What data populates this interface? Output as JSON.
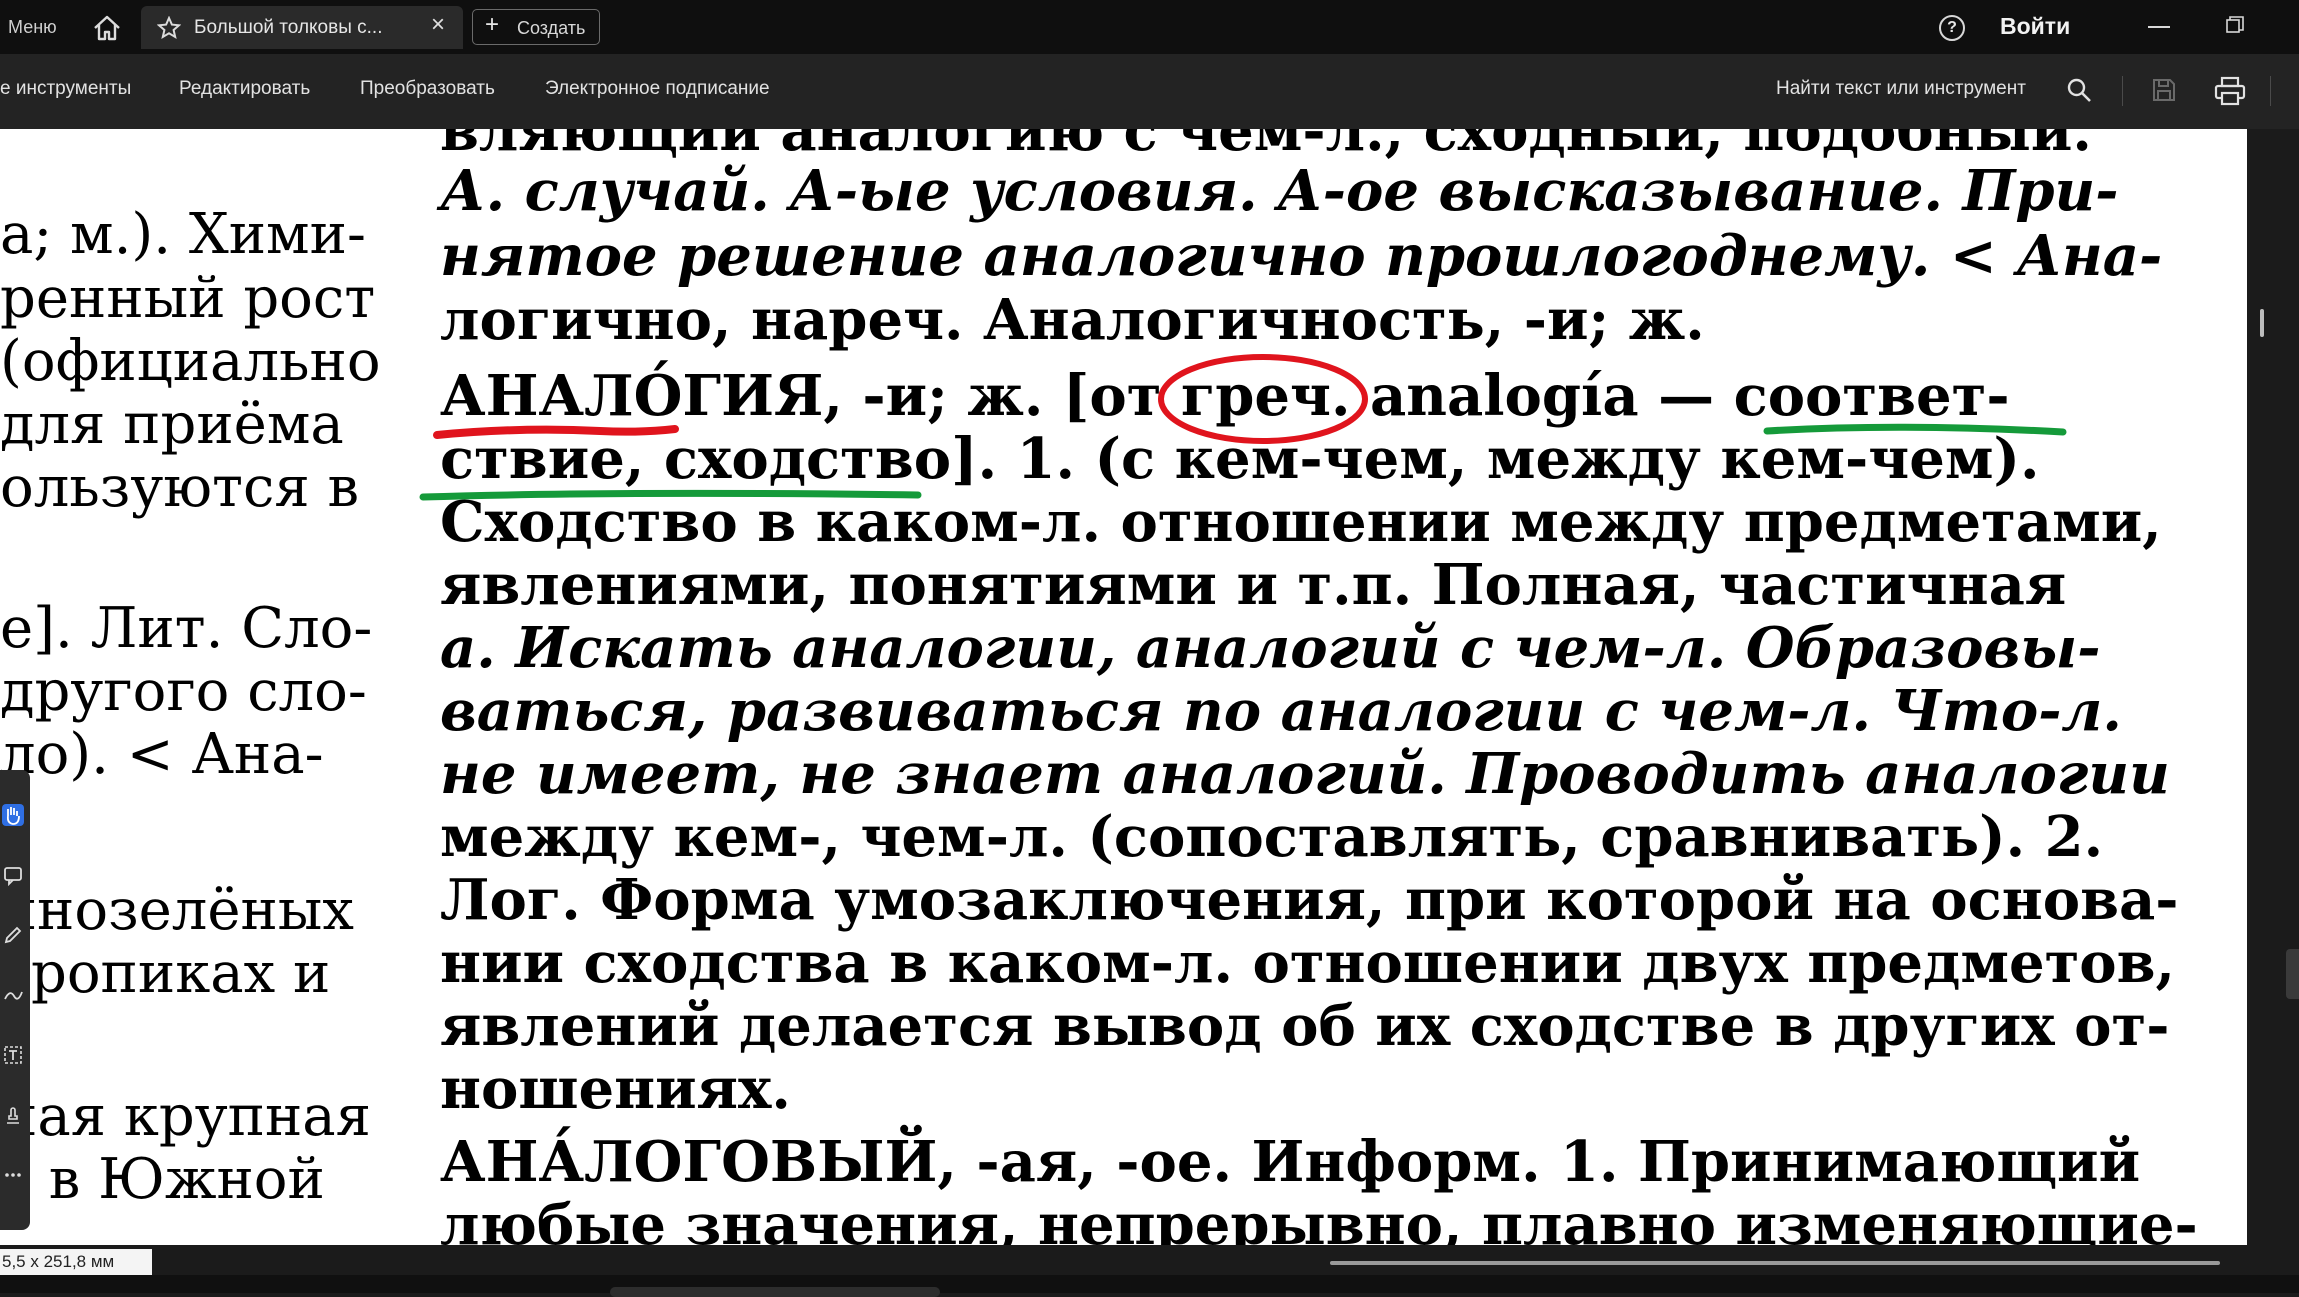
{
  "topbar": {
    "menu_label": "Меню",
    "tab_title": "Большой толковы с...",
    "tab_close": "×",
    "create_label": "Создать",
    "signin_label": "Войти",
    "help_glyph": "?"
  },
  "toolbar": {
    "items": [
      "е инструменты",
      "Редактировать",
      "Преобразовать",
      "Электронное подписание"
    ],
    "search_label": "Найти текст или инструмент"
  },
  "status": {
    "page_size": "5,5 x 251,8 мм"
  },
  "document": {
    "left_lines": [
      "а; м.). Хими-",
      "ренный рост",
      "(официально",
      "для приёма",
      "ользуются в",
      "",
      "е]. Лит. Сло-",
      "другого сло-",
      "ло). < Ана-",
      "",
      "чнозелёных",
      "тропиках и",
      "",
      "ная крупная",
      "т в Южной"
    ],
    "main_lines": [
      "вляющий аналогию с чем-л., сходный, подобный.",
      "А. случай. А-ые условия. А-ое высказывание. При-",
      "нятое решение аналогично прошлогоднему. < Ана-",
      "логично, нареч. Аналогичность, -и; ж.",
      "АНАЛО́ГИЯ, -и; ж. [от греч. analogía — соответ-",
      "ствие, сходство]. 1. (с кем-чем, между кем-чем).",
      "Сходство в каком-л. отношении между предметами,",
      "явлениями, понятиями и т.п. Полная, частичная",
      "а. Искать аналогии, аналогий с чем-л. Образовы-",
      "ваться, развиваться по аналогии с чем-л. Что-л.",
      "не имеет, не знает аналогий. Проводить аналогии",
      "между кем-, чем-л. (сопоставлять, сравнивать). 2.",
      "Лог. Форма умозаключения, при которой на основа-",
      "нии сходства в каком-л. отношении двух предметов,",
      "явлений делается вывод об их сходстве в других от-",
      "ношениях.",
      "АНА́ЛОГОВЫЙ, -ая, -ое. Информ. 1. Принимающий",
      "любые значения, непрерывно, плавно изменяющие-"
    ]
  },
  "annotations": {
    "underline_red": "#e0141d",
    "underline_green": "#159a3a",
    "circle_red": "#e0141d"
  },
  "icons": [
    "home-icon",
    "star-icon",
    "plus-icon",
    "help-icon",
    "minimize-icon",
    "restore-icon",
    "search-icon",
    "save-icon",
    "print-icon"
  ]
}
